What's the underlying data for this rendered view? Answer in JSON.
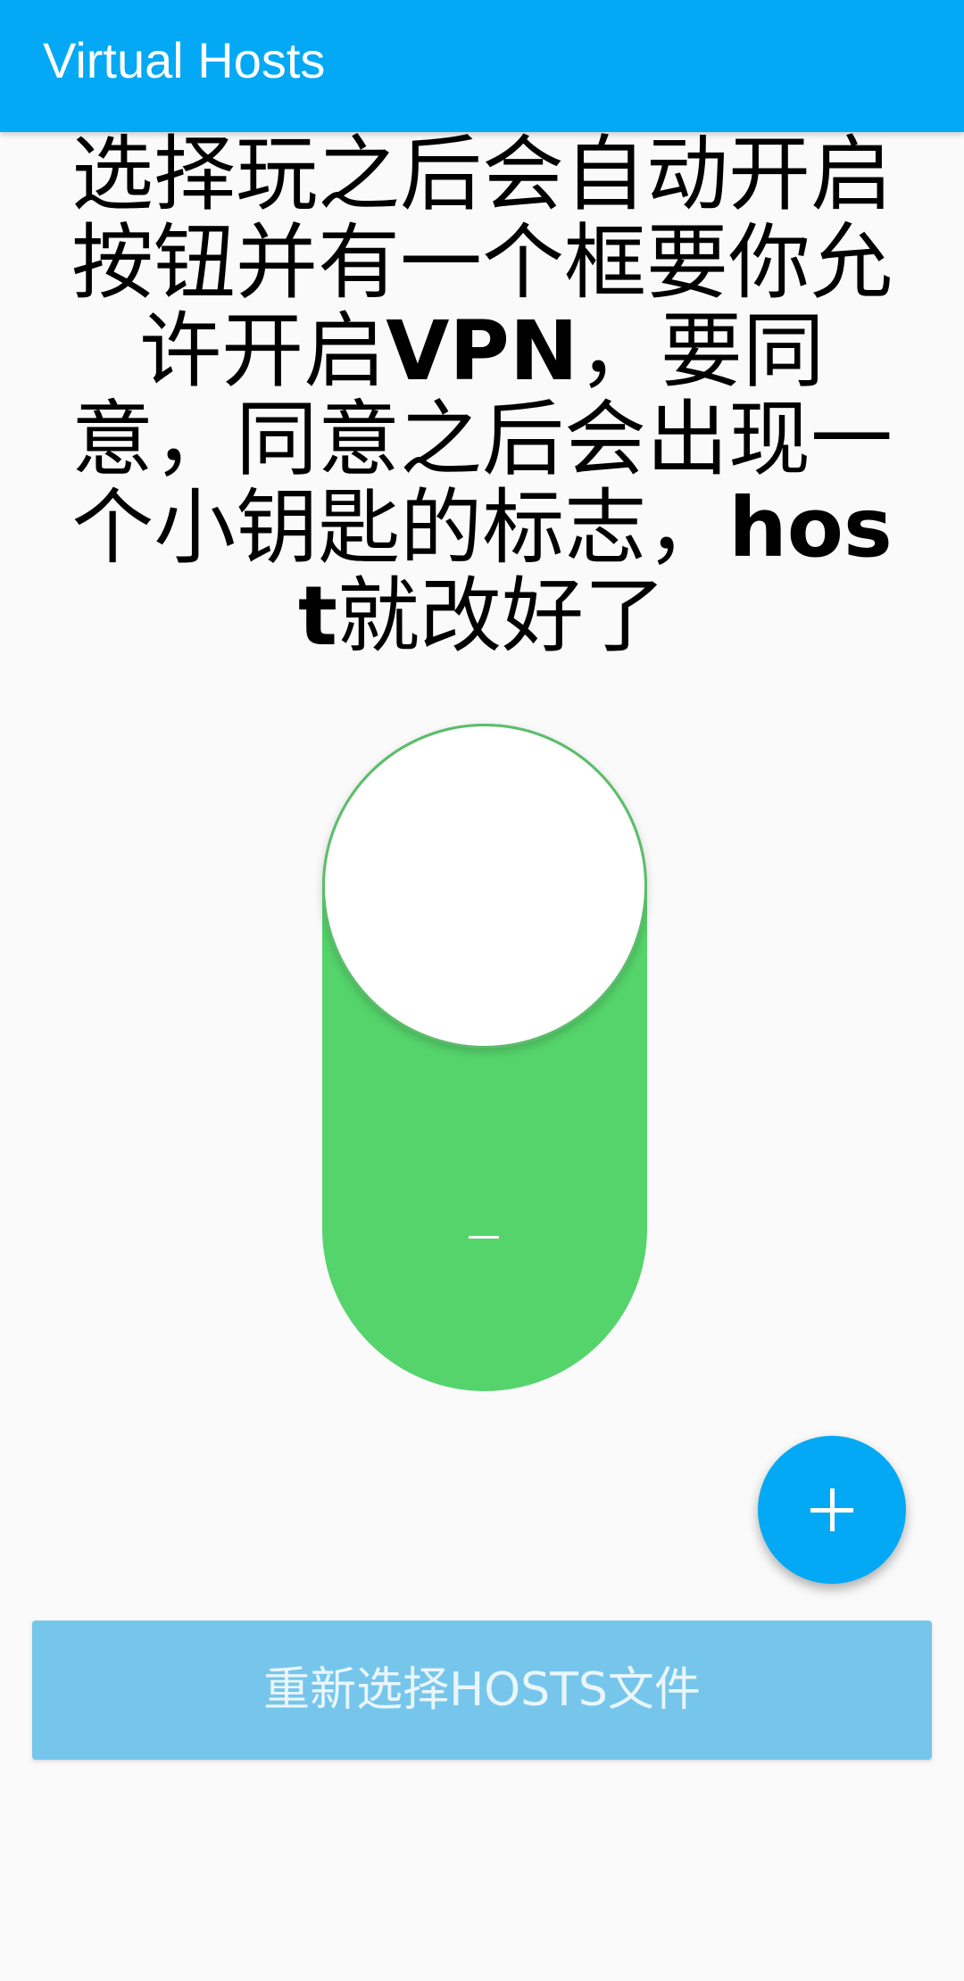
{
  "app_bar": {
    "title": "Virtual Hosts",
    "background_color": "#03a9f4"
  },
  "overlay_caption": {
    "part1": "选择玩之后会自动开启按钮并有一个框要你允许开启",
    "part2": "VPN",
    "part3": "，要同意，同意之后会出现一个小钥匙的标志，",
    "part4": "host",
    "part5": "就改好了"
  },
  "vpn_toggle": {
    "state": "on",
    "track_color": "#55d46b",
    "knob_color": "#ffffff",
    "mark": "–"
  },
  "fab": {
    "icon": "plus-icon",
    "color": "#03a9f4"
  },
  "reselect_button": {
    "label": "重新选择HOSTS文件",
    "color": "#76c6ec"
  }
}
